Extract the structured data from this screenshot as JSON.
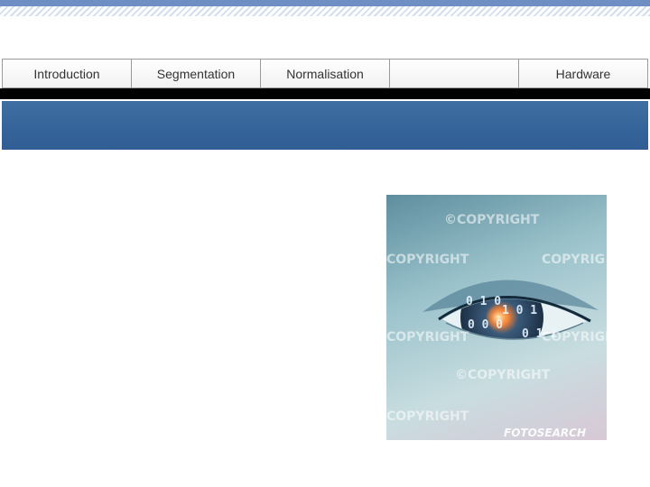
{
  "nav": {
    "items": [
      {
        "label": "Introduction"
      },
      {
        "label": "Segmentation"
      },
      {
        "label": "Normalisation"
      },
      {
        "label": ""
      },
      {
        "label": "Hardware"
      }
    ]
  },
  "image": {
    "watermarks": [
      "©COPYRIGHT",
      "COPYRIGHT",
      "COPYRIG",
      "COPYRIGHT",
      "COPYRIGHT",
      "©COPYRIGHT",
      "COPYRIGHT"
    ],
    "brand": "FOTOSEARCH",
    "binary": [
      "0 1 0",
      "1 0 1",
      "0 0 0",
      "0 1 1"
    ],
    "colors": {
      "iris": "#3a5a7a",
      "glow": "#ffb347"
    }
  }
}
